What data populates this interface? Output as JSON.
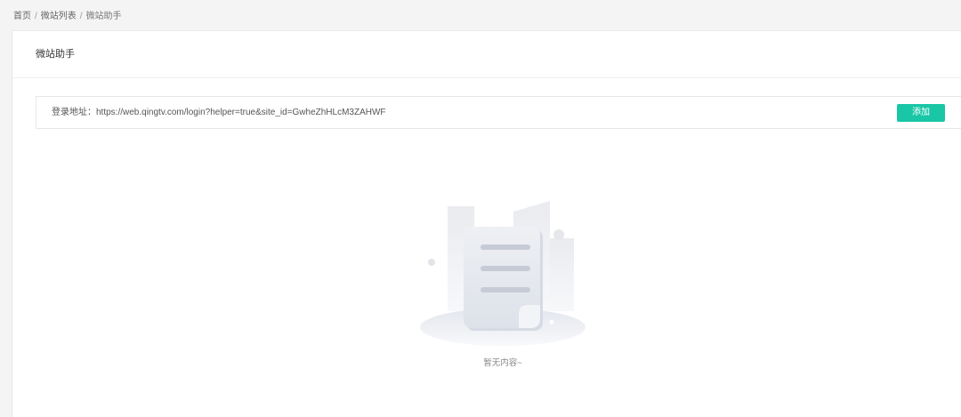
{
  "breadcrumb": {
    "items": [
      {
        "label": "首页"
      },
      {
        "label": "微站列表"
      },
      {
        "label": "微站助手"
      }
    ],
    "separator": "/"
  },
  "card": {
    "title": "微站助手"
  },
  "login_bar": {
    "label": "登录地址：",
    "url": "https://web.qingtv.com/login?helper=true&site_id=GwheZhHLcM3ZAHWF",
    "add_button_label": "添加"
  },
  "empty_state": {
    "icon": "empty-document-icon",
    "text": "暂无内容~"
  },
  "colors": {
    "accent": "#19c6a6"
  }
}
